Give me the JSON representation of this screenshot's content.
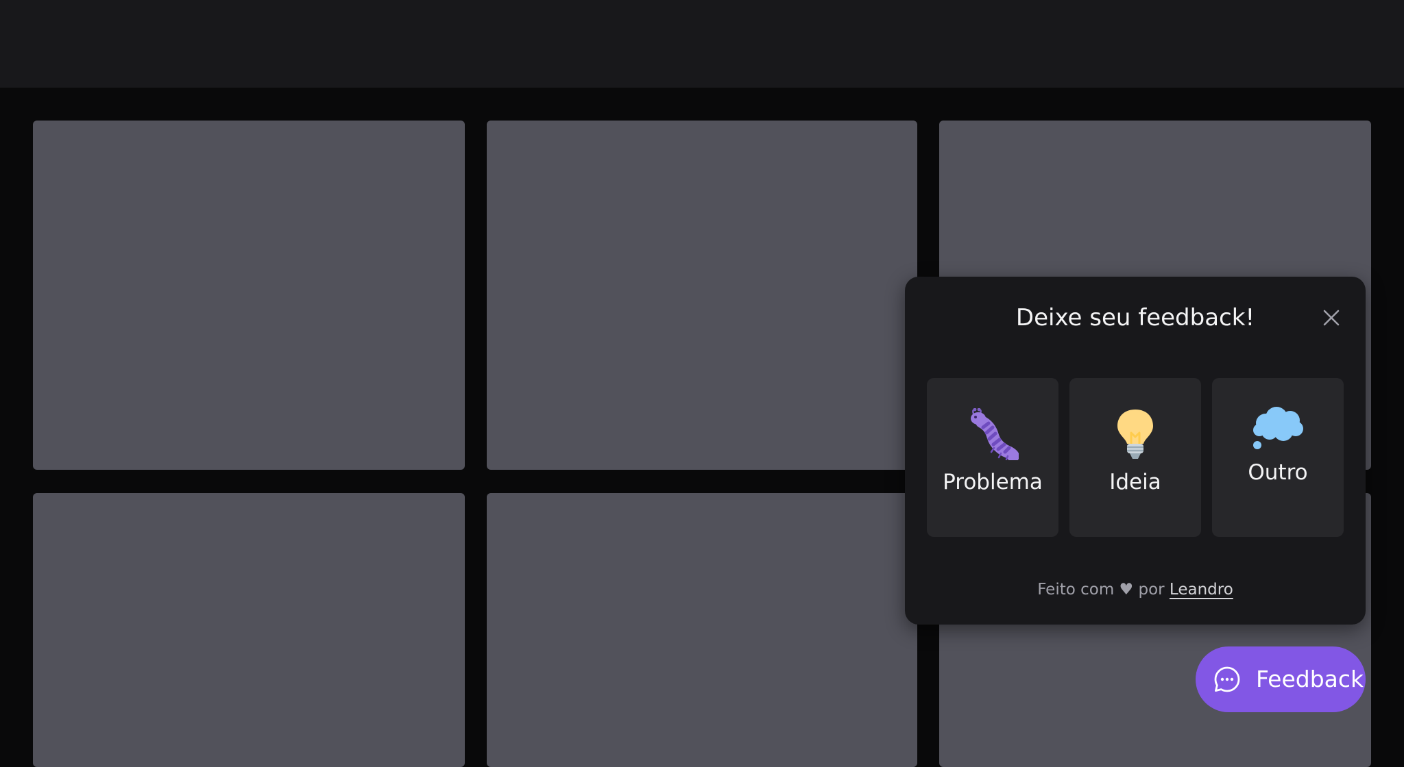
{
  "colors": {
    "page_background": "#09090a",
    "topbar": "#18181b",
    "placeholder_card": "#52525b",
    "widget_background": "#18181b",
    "option_background": "#27272a",
    "brand": "#8257e5"
  },
  "widget": {
    "title": "Deixe seu feedback!",
    "close_icon": "close-icon",
    "options": [
      {
        "label": "Problema",
        "icon": "bug-icon"
      },
      {
        "label": "Ideia",
        "icon": "lightbulb-icon"
      },
      {
        "label": "Outro",
        "icon": "thought-bubble-icon"
      }
    ],
    "footer": {
      "prefix": "Feito com ♥ por ",
      "author": "Leandro"
    }
  },
  "fab": {
    "label": "Feedback",
    "icon": "chat-bubble-icon"
  }
}
